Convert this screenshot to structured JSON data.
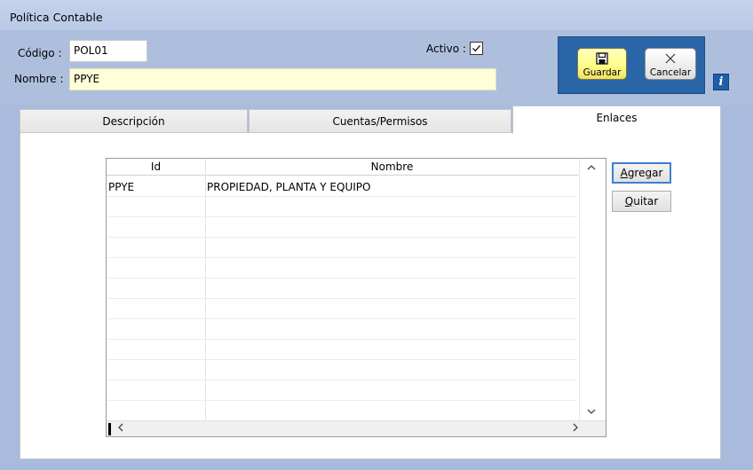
{
  "window": {
    "title": "Política Contable"
  },
  "form": {
    "codigo_label": "Código :",
    "codigo_value": "POL01",
    "nombre_label": "Nombre :",
    "nombre_value": "PPYE",
    "activo_label": "Activo :",
    "activo_checked": true
  },
  "toolbar": {
    "guardar_label": "Guardar",
    "cancelar_label": "Cancelar",
    "info_icon": "i"
  },
  "tabs": [
    {
      "label": "Descripción",
      "selected": false
    },
    {
      "label": "Cuentas/Permisos",
      "selected": false
    },
    {
      "label": "Enlaces",
      "selected": true
    }
  ],
  "grid": {
    "columns": [
      "Id",
      "Nombre"
    ],
    "rows": [
      {
        "id": "PPYE",
        "nombre": "PROPIEDAD, PLANTA Y EQUIPO"
      }
    ]
  },
  "side_buttons": {
    "agregar_first": "A",
    "agregar_rest": "gregar",
    "quitar_first": "Q",
    "quitar_rest": "uitar"
  },
  "colors": {
    "panel_blue": "#2a65a8",
    "background": "#aebfde",
    "highlight_field": "#fefed9"
  },
  "icons": {
    "save": "floppy-disk-icon",
    "cancel": "x-cross-icon",
    "info": "info-icon"
  }
}
